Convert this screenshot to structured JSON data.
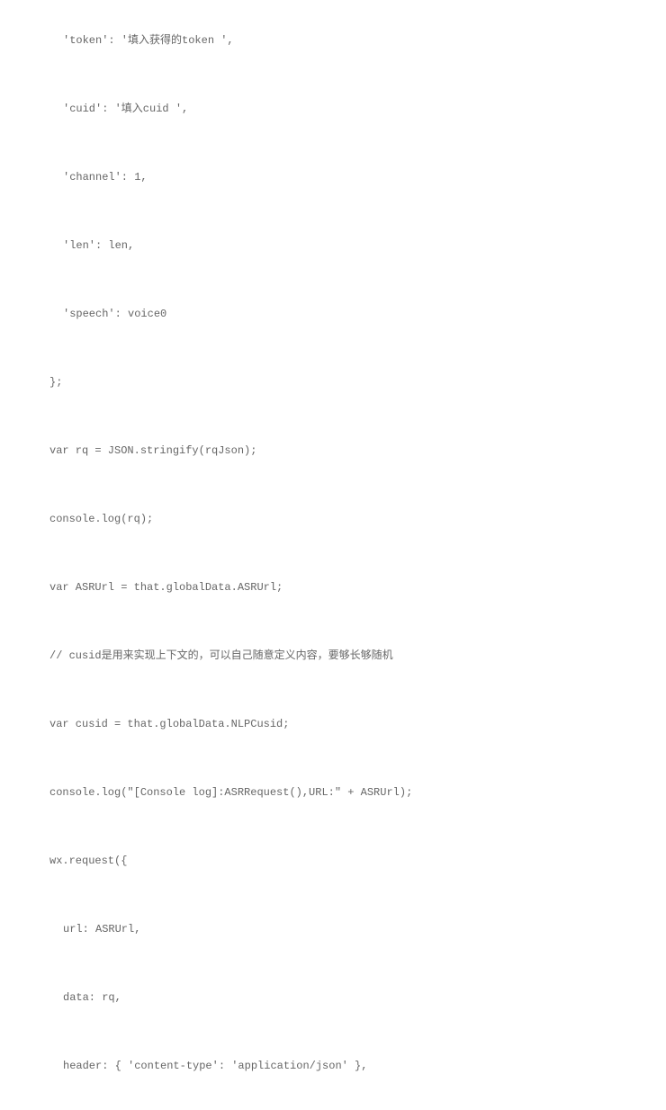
{
  "code": {
    "lines": [
      {
        "text": "'token': '填入获得的token ',",
        "indent": 3
      },
      {
        "text": "'cuid': '填入cuid ',",
        "indent": 3
      },
      {
        "text": "'channel': 1,",
        "indent": 3
      },
      {
        "text": "'len': len,",
        "indent": 3
      },
      {
        "text": "'speech': voice0",
        "indent": 3
      },
      {
        "text": "};",
        "indent": 2
      },
      {
        "text": "var rq = JSON.stringify(rqJson);",
        "indent": 2
      },
      {
        "text": "console.log(rq);",
        "indent": 2
      },
      {
        "text": "var ASRUrl = that.globalData.ASRUrl;",
        "indent": 2
      },
      {
        "text": "// cusid是用来实现上下文的，可以自己随意定义内容，要够长够随机",
        "indent": 2
      },
      {
        "text": "var cusid = that.globalData.NLPCusid;",
        "indent": 2
      },
      {
        "text": "console.log(\"[Console log]:ASRRequest(),URL:\" + ASRUrl);",
        "indent": 2
      },
      {
        "text": "wx.request({",
        "indent": 2
      },
      {
        "text": "url: ASRUrl,",
        "indent": 3
      },
      {
        "text": "data: rq,",
        "indent": 3
      },
      {
        "text": "header: { 'content-type': 'application/json' },",
        "indent": 3
      }
    ]
  }
}
